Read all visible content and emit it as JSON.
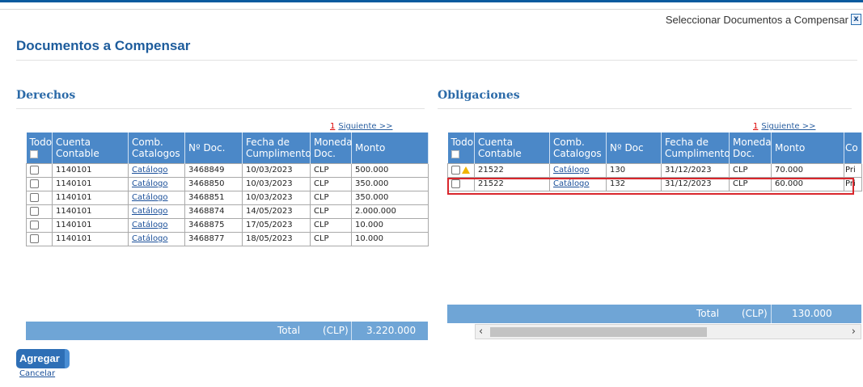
{
  "window": {
    "title": "Seleccionar Documentos a Compensar",
    "close_symbol": "x"
  },
  "page_title": "Documentos a Compensar",
  "derechos": {
    "title": "Derechos",
    "pager": {
      "page": "1",
      "next": "Siguiente >>"
    },
    "headers": {
      "todo": "Todo",
      "cuenta": "Cuenta Contable",
      "comb": "Comb. Catalogos",
      "ndoc": "Nº Doc.",
      "fecha": "Fecha de Cumplimento",
      "moneda": "Moneda Doc.",
      "monto": "Monto"
    },
    "rows": [
      {
        "cuenta": "1140101",
        "catalogo": "Catálogo",
        "ndoc": "3468849",
        "fecha": "10/03/2023",
        "moneda": "CLP",
        "monto": "500.000"
      },
      {
        "cuenta": "1140101",
        "catalogo": "Catálogo",
        "ndoc": "3468850",
        "fecha": "10/03/2023",
        "moneda": "CLP",
        "monto": "350.000"
      },
      {
        "cuenta": "1140101",
        "catalogo": "Catálogo",
        "ndoc": "3468851",
        "fecha": "10/03/2023",
        "moneda": "CLP",
        "monto": "350.000"
      },
      {
        "cuenta": "1140101",
        "catalogo": "Catálogo",
        "ndoc": "3468874",
        "fecha": "14/05/2023",
        "moneda": "CLP",
        "monto": "2.000.000"
      },
      {
        "cuenta": "1140101",
        "catalogo": "Catálogo",
        "ndoc": "3468875",
        "fecha": "17/05/2023",
        "moneda": "CLP",
        "monto": "10.000"
      },
      {
        "cuenta": "1140101",
        "catalogo": "Catálogo",
        "ndoc": "3468877",
        "fecha": "18/05/2023",
        "moneda": "CLP",
        "monto": "10.000"
      }
    ],
    "total": {
      "label": "Total",
      "currency": "(CLP)",
      "value": "3.220.000"
    }
  },
  "obligaciones": {
    "title": "Obligaciones",
    "pager": {
      "page": "1",
      "next": "Siguiente >>"
    },
    "headers": {
      "todo": "Todo",
      "cuenta": "Cuenta Contable",
      "comb": "Comb. Catalogos",
      "ndoc": "Nº Doc",
      "fecha": "Fecha de Cumplimento",
      "moneda": "Moneda Doc.",
      "monto": "Monto",
      "extra": "Co"
    },
    "rows": [
      {
        "cuenta": "21522",
        "catalogo": "Catálogo",
        "ndoc": "130",
        "fecha": "31/12/2023",
        "moneda": "CLP",
        "monto": "70.000",
        "extra": "Pri",
        "warning": true
      },
      {
        "cuenta": "21522",
        "catalogo": "Catálogo",
        "ndoc": "132",
        "fecha": "31/12/2023",
        "moneda": "CLP",
        "monto": "60.000",
        "extra": "Pri",
        "warning": false
      }
    ],
    "total": {
      "label": "Total",
      "currency": "(CLP)",
      "value": "130.000"
    }
  },
  "actions": {
    "agregar": "Agregar",
    "cancelar": "Cancelar"
  },
  "colors": {
    "header_blue": "#4b88c8",
    "total_blue": "#6fa5d6",
    "title_blue": "#1d5c9c",
    "highlight_red": "#d9262c"
  }
}
